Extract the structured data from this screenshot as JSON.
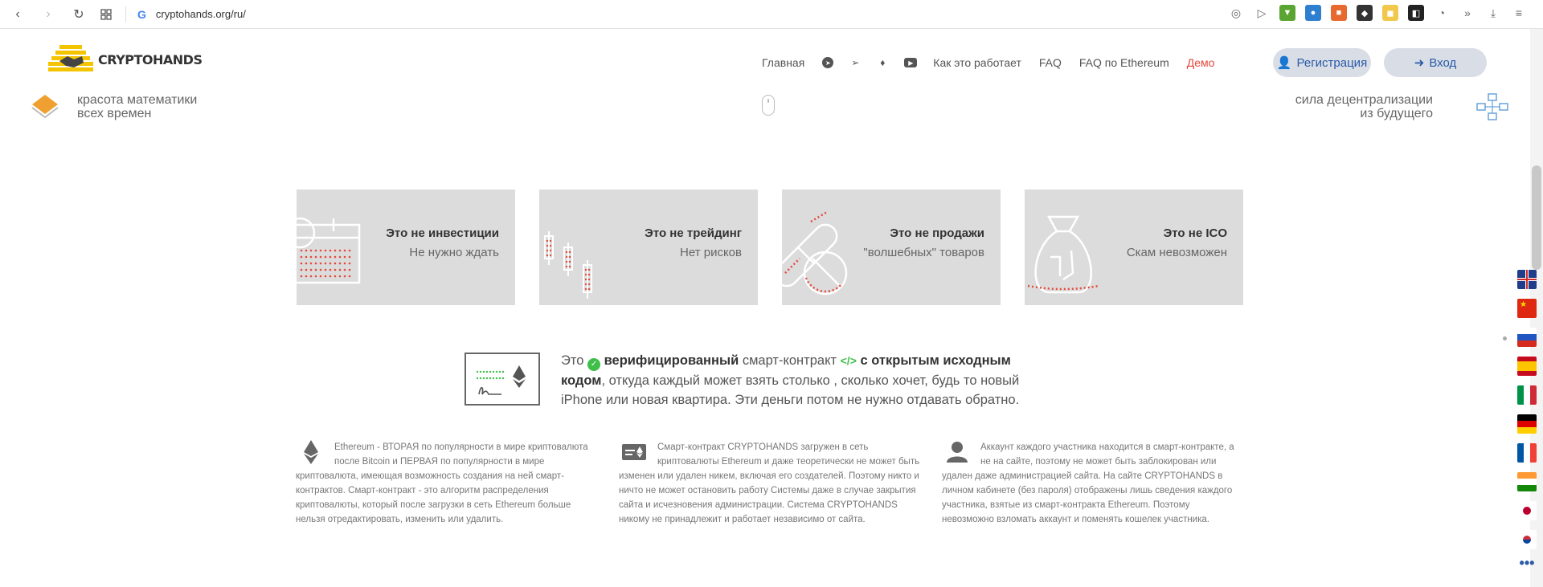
{
  "browser": {
    "url": "cryptohands.org/ru/",
    "back_icon": "‹",
    "forward_icon": "›",
    "reload_icon": "↻",
    "google_letter": "G",
    "overflow": "»",
    "download_icon": "⤓",
    "menu_icon": "≡"
  },
  "header": {
    "logo_text": "CRYPTOHANDS",
    "nav": {
      "home": "Главная",
      "how": "Как это работает",
      "faq": "FAQ",
      "faq_eth": "FAQ по Ethereum",
      "demo": "Демо"
    },
    "register_label": "Регистрация",
    "login_label": "Вход"
  },
  "hero": {
    "left_line1": "красота математики",
    "left_line2": "всех времен",
    "right_line1": "сила децентрализации",
    "right_line2": "из будущего"
  },
  "cards": [
    {
      "title": "Это не инвестиции",
      "sub": "Не нужно ждать"
    },
    {
      "title": "Это не трейдинг",
      "sub": "Нет рисков"
    },
    {
      "title": "Это не продажи",
      "sub": "\"волшебных\" товаров"
    },
    {
      "title": "Это не ICO",
      "sub": "Скам невозможен"
    }
  ],
  "verified": {
    "t1": "Это",
    "t2": "верифицированный",
    "t3": "смарт-контракт",
    "t4": "с открытым исходным кодом",
    "t5": ", откуда каждый может взять столько , сколько хочет, будь то новый iPhone или новая квартира. Эти деньги потом не нужно отдавать обратно.",
    "ok": "✓",
    "code": "</>"
  },
  "info": [
    "Ethereum - ВТОРАЯ по популярности в мире криптовалюта после Bitcoin и ПЕРВАЯ по популярности в мире криптовалюта, имеющая возможность создания на ней смарт-контрактов. Смарт-контракт - это алгоритм распределения криптовалюты, который после загрузки в сеть Ethereum больше нельзя отредактировать, изменить или удалить.",
    "Смарт-контракт CRYPTOHANDS загружен в сеть криптовалюты Ethereum и даже теоретически не может быть изменен или удален никем, включая его создателей. Поэтому никто и ничто не может остановить работу Системы даже в случае закрытия сайта и исчезновения администрации. Система CRYPTOHANDS никому не принадлежит и работает независимо от сайта.",
    "Аккаунт каждого участника находится в смарт-контракте, а не на сайте, поэтому не может быть заблокирован или удален даже администрацией сайта. На сайте CRYPTOHANDS в личном кабинете (без пароля) отображены лишь сведения каждого участника, взятые из смарт-контракта Ethereum. Поэтому невозможно взломать аккаунт и поменять кошелек участника."
  ],
  "flags": [
    "gb-flag-icon",
    "cn-flag-icon",
    "ru-flag-icon",
    "es-flag-icon",
    "it-flag-icon",
    "de-flag-icon",
    "fr-flag-icon",
    "in-flag-icon",
    "jp-flag-icon",
    "kr-flag-icon"
  ],
  "more": "•••"
}
